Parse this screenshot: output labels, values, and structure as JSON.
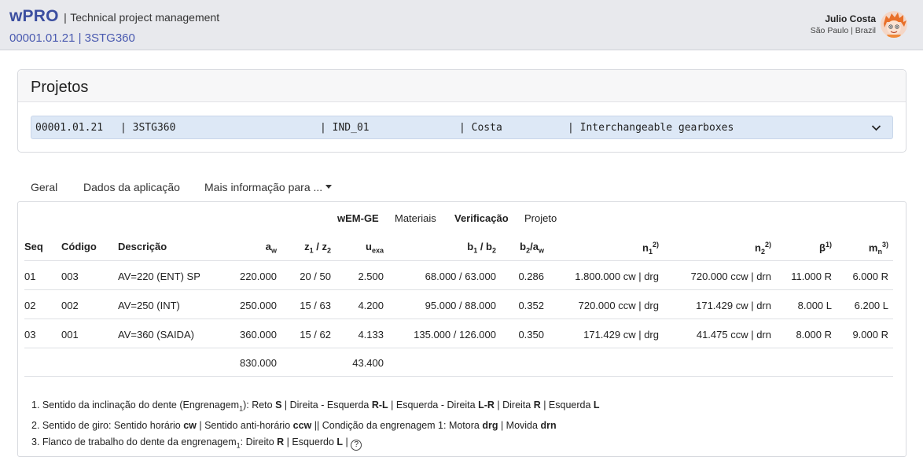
{
  "header": {
    "brand": "wPRO",
    "separator": "|",
    "tagline": "Technical project management",
    "subtitle": "00001.01.21 | 3STG360",
    "user_name": "Julio Costa",
    "user_location": "São Paulo | Brazil"
  },
  "projects": {
    "title": "Projetos",
    "selected": {
      "code": "00001.01.21",
      "name": "| 3STG360",
      "ind": "| IND_01",
      "owner": "| Costa",
      "desc": "| Interchangeable gearboxes"
    }
  },
  "tabs": {
    "geral": "Geral",
    "dados": "Dados da aplicação",
    "mais": "Mais informação para ..."
  },
  "subtabs": {
    "wem": "wEM-GE",
    "materiais": "Materiais",
    "verificacao": "Verificação",
    "projeto": "Projeto"
  },
  "table": {
    "headers": {
      "seq": "Seq",
      "codigo": "Código",
      "descricao": "Descrição",
      "aw": "a",
      "aw_sub": "w",
      "z_a": "z",
      "z_a_sub": "1",
      "z_mid": " / z",
      "z_b_sub": "2",
      "uexa": "u",
      "uexa_sub": "exa",
      "b_a": "b",
      "b_a_sub": "1",
      "b_mid": " / b",
      "b_b_sub": "2",
      "baw_a": "b",
      "baw_a_sub": "2",
      "baw_mid": "/a",
      "baw_b_sub": "w",
      "n1": "n",
      "n1_sub": "1",
      "n1_sup": "2)",
      "n2": "n",
      "n2_sub": "2",
      "n2_sup": "2)",
      "beta": "β",
      "beta_sup": "1)",
      "mn": "m",
      "mn_sub": "n",
      "mn_sup": "3)"
    },
    "rows": [
      {
        "seq": "01",
        "codigo": "003",
        "descricao": "AV=220 (ENT) SP",
        "aw": "220.000",
        "z": "20 / 50",
        "uexa": "2.500",
        "b": "68.000 / 63.000",
        "baw": "0.286",
        "n1": "1.800.000 cw | drg",
        "n2": "720.000 ccw | drn",
        "beta": "11.000 R",
        "mn": "6.000 R"
      },
      {
        "seq": "02",
        "codigo": "002",
        "descricao": "AV=250 (INT)",
        "aw": "250.000",
        "z": "15 / 63",
        "uexa": "4.200",
        "b": "95.000 / 88.000",
        "baw": "0.352",
        "n1": "720.000 ccw | drg",
        "n2": "171.429 cw | drn",
        "beta": "8.000 L",
        "mn": "6.200 L"
      },
      {
        "seq": "03",
        "codigo": "001",
        "descricao": "AV=360 (SAIDA)",
        "aw": "360.000",
        "z": "15 / 62",
        "uexa": "4.133",
        "b": "135.000 / 126.000",
        "baw": "0.350",
        "n1": "171.429 cw | drg",
        "n2": "41.475 ccw | drn",
        "beta": "8.000 R",
        "mn": "9.000 R"
      }
    ],
    "totals": {
      "aw": "830.000",
      "uexa": "43.400"
    }
  },
  "notes": {
    "n1_a": "1. Sentido da inclinação do dente (Engrenagem",
    "n1_sub": "1",
    "n1_b": "): Reto ",
    "n1_S": "S",
    "n1_c": " | Direita - Esquerda ",
    "n1_RL": "R-L",
    "n1_d": " | Esquerda - Direita ",
    "n1_LR": "L-R",
    "n1_e": " | Direita ",
    "n1_R": "R",
    "n1_f": " | Esquerda ",
    "n1_L": "L",
    "n2_a": "2. Sentido de giro: Sentido horário ",
    "n2_cw": "cw",
    "n2_b": " | Sentido anti-horário ",
    "n2_ccw": "ccw",
    "n2_c": " || Condição da engrenagem 1: Motora ",
    "n2_drg": "drg",
    "n2_d": " | Movida ",
    "n2_drn": "drn",
    "n3_a": "3. Flanco de trabalho do dente da engrenagem",
    "n3_sub": "1",
    "n3_b": ": Direito ",
    "n3_R": "R",
    "n3_c": " | Esquerdo ",
    "n3_L": "L",
    "n3_d": " | ",
    "help": "?"
  }
}
